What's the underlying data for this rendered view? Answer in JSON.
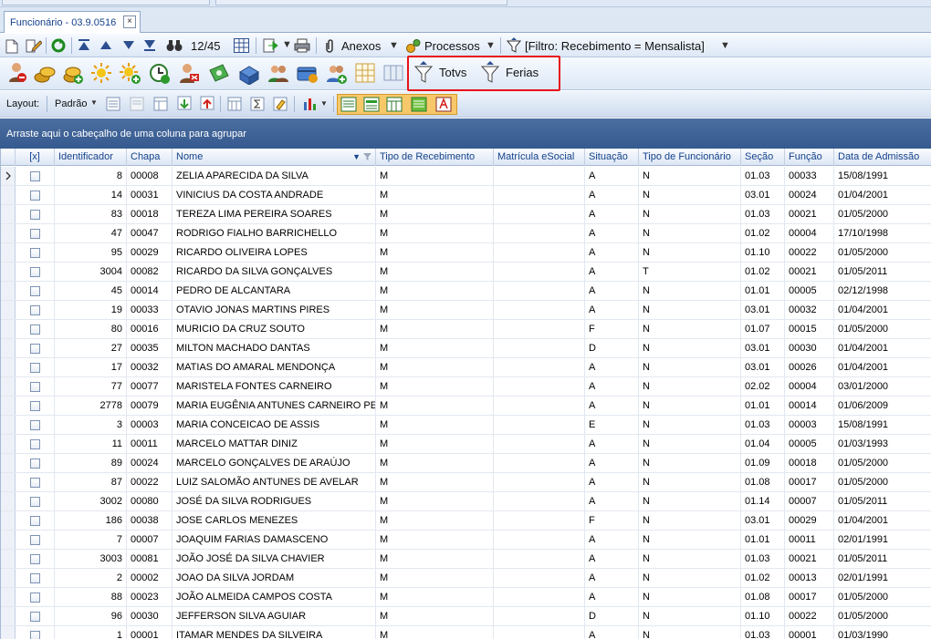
{
  "tab": {
    "title": "Funcionário - 03.9.0516",
    "close": "×"
  },
  "toolbar1": {
    "record_position": "12/45",
    "anexos_label": "Anexos",
    "processos_label": "Processos",
    "filter_label": "[Filtro: Recebimento = Mensalista]"
  },
  "toolbar2": {
    "totvs_label": "Totvs",
    "ferias_label": "Ferias"
  },
  "toolbar3": {
    "layout_label": "Layout:",
    "layout_value": "Padrão"
  },
  "groupbar": {
    "text": "Arraste aqui o cabeçalho de uma coluna para agrupar"
  },
  "grid": {
    "columns": [
      {
        "label": "[x]"
      },
      {
        "label": "Identificador"
      },
      {
        "label": "Chapa"
      },
      {
        "label": "Nome"
      },
      {
        "label": "Tipo de Recebimento"
      },
      {
        "label": "Matrícula eSocial"
      },
      {
        "label": "Situação"
      },
      {
        "label": "Tipo de Funcionário"
      },
      {
        "label": "Seção"
      },
      {
        "label": "Função"
      },
      {
        "label": "Data de Admissão"
      }
    ],
    "rows": [
      {
        "id": "8",
        "chapa": "00008",
        "nome": "ZELIA APARECIDA DA SILVA",
        "rec": "M",
        "mat": "",
        "sit": "A",
        "tipo": "N",
        "secao": "01.03",
        "funcao": "00033",
        "adm": "15/08/1991"
      },
      {
        "id": "14",
        "chapa": "00031",
        "nome": "VINICIUS DA COSTA ANDRADE",
        "rec": "M",
        "mat": "",
        "sit": "A",
        "tipo": "N",
        "secao": "03.01",
        "funcao": "00024",
        "adm": "01/04/2001"
      },
      {
        "id": "83",
        "chapa": "00018",
        "nome": "TEREZA LIMA PEREIRA SOARES",
        "rec": "M",
        "mat": "",
        "sit": "A",
        "tipo": "N",
        "secao": "01.03",
        "funcao": "00021",
        "adm": "01/05/2000"
      },
      {
        "id": "47",
        "chapa": "00047",
        "nome": "RODRIGO FIALHO BARRICHELLO",
        "rec": "M",
        "mat": "",
        "sit": "A",
        "tipo": "N",
        "secao": "01.02",
        "funcao": "00004",
        "adm": "17/10/1998"
      },
      {
        "id": "95",
        "chapa": "00029",
        "nome": "RICARDO OLIVEIRA LOPES",
        "rec": "M",
        "mat": "",
        "sit": "A",
        "tipo": "N",
        "secao": "01.10",
        "funcao": "00022",
        "adm": "01/05/2000"
      },
      {
        "id": "3004",
        "chapa": "00082",
        "nome": "RICARDO DA SILVA GONÇALVES",
        "rec": "M",
        "mat": "",
        "sit": "A",
        "tipo": "T",
        "secao": "01.02",
        "funcao": "00021",
        "adm": "01/05/2011"
      },
      {
        "id": "45",
        "chapa": "00014",
        "nome": "PEDRO DE ALCANTARA",
        "rec": "M",
        "mat": "",
        "sit": "A",
        "tipo": "N",
        "secao": "01.01",
        "funcao": "00005",
        "adm": "02/12/1998"
      },
      {
        "id": "19",
        "chapa": "00033",
        "nome": "OTAVIO JONAS MARTINS PIRES",
        "rec": "M",
        "mat": "",
        "sit": "A",
        "tipo": "N",
        "secao": "03.01",
        "funcao": "00032",
        "adm": "01/04/2001"
      },
      {
        "id": "80",
        "chapa": "00016",
        "nome": "MURICIO DA CRUZ SOUTO",
        "rec": "M",
        "mat": "",
        "sit": "F",
        "tipo": "N",
        "secao": "01.07",
        "funcao": "00015",
        "adm": "01/05/2000"
      },
      {
        "id": "27",
        "chapa": "00035",
        "nome": "MILTON MACHADO DANTAS",
        "rec": "M",
        "mat": "",
        "sit": "D",
        "tipo": "N",
        "secao": "03.01",
        "funcao": "00030",
        "adm": "01/04/2001"
      },
      {
        "id": "17",
        "chapa": "00032",
        "nome": "MATIAS DO AMARAL MENDONÇA",
        "rec": "M",
        "mat": "",
        "sit": "A",
        "tipo": "N",
        "secao": "03.01",
        "funcao": "00026",
        "adm": "01/04/2001"
      },
      {
        "id": "77",
        "chapa": "00077",
        "nome": "MARISTELA FONTES CARNEIRO",
        "rec": "M",
        "mat": "",
        "sit": "A",
        "tipo": "N",
        "secao": "02.02",
        "funcao": "00004",
        "adm": "03/01/2000"
      },
      {
        "id": "2778",
        "chapa": "00079",
        "nome": "MARIA EUGÊNIA ANTUNES CARNEIRO PENA",
        "rec": "M",
        "mat": "",
        "sit": "A",
        "tipo": "N",
        "secao": "01.01",
        "funcao": "00014",
        "adm": "01/06/2009"
      },
      {
        "id": "3",
        "chapa": "00003",
        "nome": "MARIA CONCEICAO DE ASSIS",
        "rec": "M",
        "mat": "",
        "sit": "E",
        "tipo": "N",
        "secao": "01.03",
        "funcao": "00003",
        "adm": "15/08/1991"
      },
      {
        "id": "11",
        "chapa": "00011",
        "nome": "MARCELO MATTAR DINIZ",
        "rec": "M",
        "mat": "",
        "sit": "A",
        "tipo": "N",
        "secao": "01.04",
        "funcao": "00005",
        "adm": "01/03/1993"
      },
      {
        "id": "89",
        "chapa": "00024",
        "nome": "MARCELO GONÇALVES DE ARAÚJO",
        "rec": "M",
        "mat": "",
        "sit": "A",
        "tipo": "N",
        "secao": "01.09",
        "funcao": "00018",
        "adm": "01/05/2000"
      },
      {
        "id": "87",
        "chapa": "00022",
        "nome": "LUIZ SALOMÃO ANTUNES DE AVELAR",
        "rec": "M",
        "mat": "",
        "sit": "A",
        "tipo": "N",
        "secao": "01.08",
        "funcao": "00017",
        "adm": "01/05/2000"
      },
      {
        "id": "3002",
        "chapa": "00080",
        "nome": "JOSÉ DA SILVA RODRIGUES",
        "rec": "M",
        "mat": "",
        "sit": "A",
        "tipo": "N",
        "secao": "01.14",
        "funcao": "00007",
        "adm": "01/05/2011"
      },
      {
        "id": "186",
        "chapa": "00038",
        "nome": "JOSE CARLOS MENEZES",
        "rec": "M",
        "mat": "",
        "sit": "F",
        "tipo": "N",
        "secao": "03.01",
        "funcao": "00029",
        "adm": "01/04/2001"
      },
      {
        "id": "7",
        "chapa": "00007",
        "nome": "JOAQUIM FARIAS DAMASCENO",
        "rec": "M",
        "mat": "",
        "sit": "A",
        "tipo": "N",
        "secao": "01.01",
        "funcao": "00011",
        "adm": "02/01/1991"
      },
      {
        "id": "3003",
        "chapa": "00081",
        "nome": "JOÃO JOSÉ DA SILVA CHAVIER",
        "rec": "M",
        "mat": "",
        "sit": "A",
        "tipo": "N",
        "secao": "01.03",
        "funcao": "00021",
        "adm": "01/05/2011"
      },
      {
        "id": "2",
        "chapa": "00002",
        "nome": "JOAO DA SILVA JORDAM",
        "rec": "M",
        "mat": "",
        "sit": "A",
        "tipo": "N",
        "secao": "01.02",
        "funcao": "00013",
        "adm": "02/01/1991"
      },
      {
        "id": "88",
        "chapa": "00023",
        "nome": "JOÃO ALMEIDA CAMPOS COSTA",
        "rec": "M",
        "mat": "",
        "sit": "A",
        "tipo": "N",
        "secao": "01.08",
        "funcao": "00017",
        "adm": "01/05/2000"
      },
      {
        "id": "96",
        "chapa": "00030",
        "nome": "JEFFERSON SILVA AGUIAR",
        "rec": "M",
        "mat": "",
        "sit": "D",
        "tipo": "N",
        "secao": "01.10",
        "funcao": "00022",
        "adm": "01/05/2000"
      },
      {
        "id": "1",
        "chapa": "00001",
        "nome": "ITAMAR MENDES DA SILVEIRA",
        "rec": "M",
        "mat": "",
        "sit": "A",
        "tipo": "N",
        "secao": "01.03",
        "funcao": "00001",
        "adm": "01/03/1990"
      }
    ]
  },
  "colors": {
    "accent": "#15428b",
    "highlight_box": "#e8101a",
    "groupbar": "#3f6396"
  }
}
